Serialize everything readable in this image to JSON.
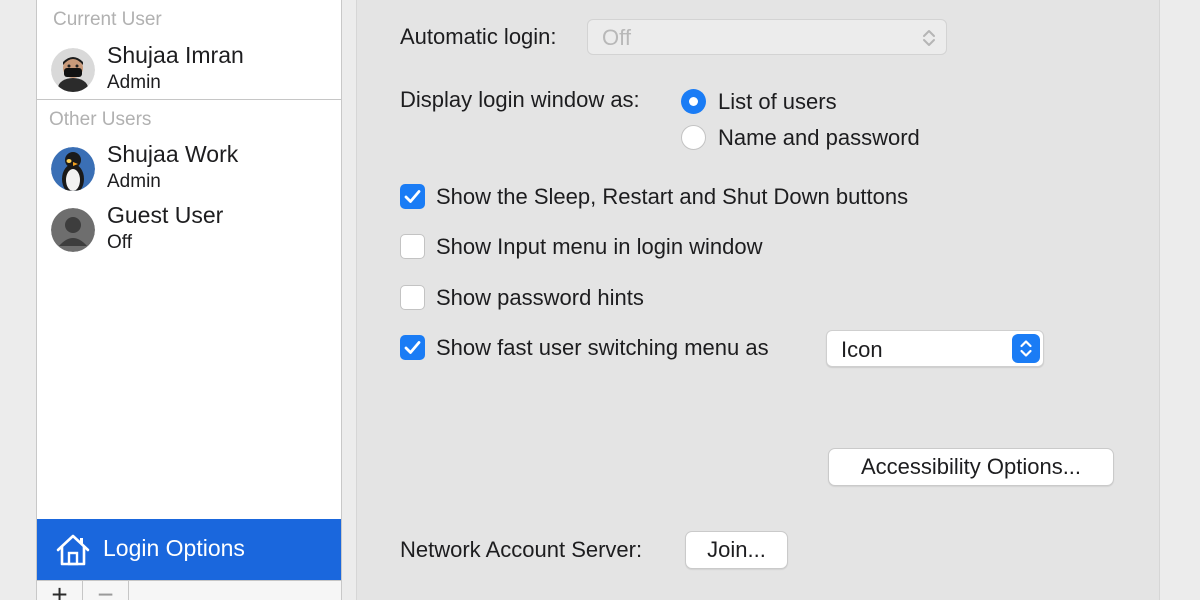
{
  "sidebar": {
    "current_user_header": "Current User",
    "other_users_header": "Other Users",
    "current_user": {
      "name": "Shujaa Imran",
      "role": "Admin"
    },
    "other_users": [
      {
        "name": "Shujaa Work",
        "role": "Admin"
      },
      {
        "name": "Guest User",
        "role": "Off"
      }
    ],
    "login_options_label": "Login Options",
    "add_symbol": "+",
    "remove_symbol": "−"
  },
  "main": {
    "automatic_login": {
      "label": "Automatic login:",
      "value": "Off"
    },
    "display_login_window": {
      "label": "Display login window as:",
      "options": [
        "List of users",
        "Name and password"
      ],
      "selected": 0
    },
    "checkboxes": [
      {
        "label": "Show the Sleep, Restart and Shut Down buttons",
        "checked": true
      },
      {
        "label": "Show Input menu in login window",
        "checked": false
      },
      {
        "label": "Show password hints",
        "checked": false
      },
      {
        "label": "Show fast user switching menu as",
        "checked": true
      }
    ],
    "fast_user_switching_value": "Icon",
    "accessibility_button": "Accessibility Options...",
    "network_account_server": {
      "label": "Network Account Server:",
      "button": "Join..."
    }
  },
  "colors": {
    "accent": "#1a7cf5",
    "selection": "#1a67dd"
  }
}
